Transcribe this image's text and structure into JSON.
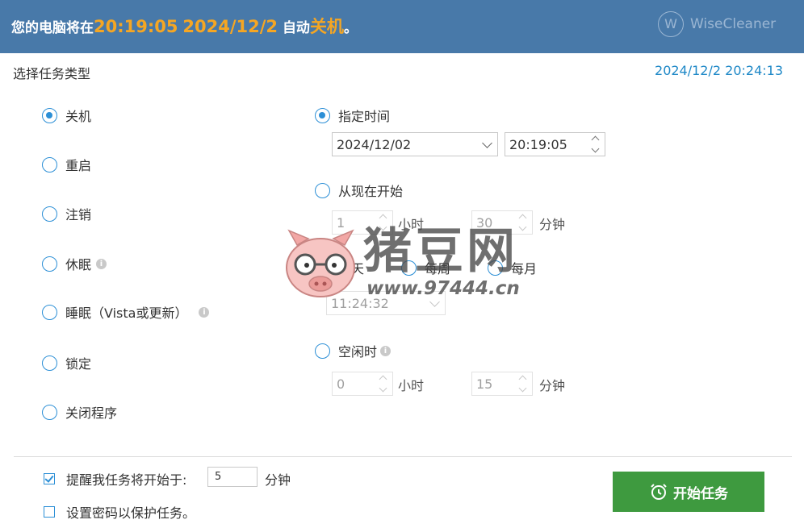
{
  "header": {
    "msg_prefix": "您的电脑将在",
    "time": "20:19:05",
    "date": "2024/12/2",
    "msg_middle": "自动",
    "action": "关机",
    "msg_suffix": "。",
    "brand_logo_letter": "W",
    "brand_name": "WiseCleaner"
  },
  "section_title": "选择任务类型",
  "current_time": "2024/12/2 20:24:13",
  "task_types": [
    {
      "label": "关机",
      "checked": true
    },
    {
      "label": "重启",
      "checked": false
    },
    {
      "label": "注销",
      "checked": false
    },
    {
      "label": "休眠",
      "checked": false
    },
    {
      "label": "睡眠（Vista或更新）",
      "checked": false
    },
    {
      "label": "锁定",
      "checked": false
    },
    {
      "label": "关闭程序",
      "checked": false
    }
  ],
  "schedule": {
    "specified": {
      "label": "指定时间",
      "checked": true,
      "date_value": "2024/12/02",
      "time_value": "20:19:05"
    },
    "from_now": {
      "label": "从现在开始",
      "checked": false,
      "hours": "1",
      "hours_unit": "小时",
      "minutes": "30",
      "minutes_unit": "分钟"
    },
    "periodic": {
      "daily": "每天",
      "weekly": "每周",
      "monthly": "每月",
      "time_value": "11:24:32"
    },
    "idle": {
      "label": "空闲时",
      "checked": false,
      "hours": "0",
      "hours_unit": "小时",
      "minutes": "15",
      "minutes_unit": "分钟"
    }
  },
  "info_icon_glyph": "i",
  "footer": {
    "remind_label": "提醒我任务将开始于:",
    "remind_checked": true,
    "remind_value": "5",
    "remind_unit": "分钟",
    "password_label": "设置密码以保护任务。",
    "password_checked": false,
    "start_button": "开始任务"
  },
  "watermark": {
    "text": "猪豆网",
    "url": "www.97444.cn"
  },
  "colors": {
    "header_bg": "#4879a9",
    "accent": "#f5a623",
    "link": "#1e88c7",
    "radio": "#2c8fd6",
    "button": "#3e9a3f"
  }
}
